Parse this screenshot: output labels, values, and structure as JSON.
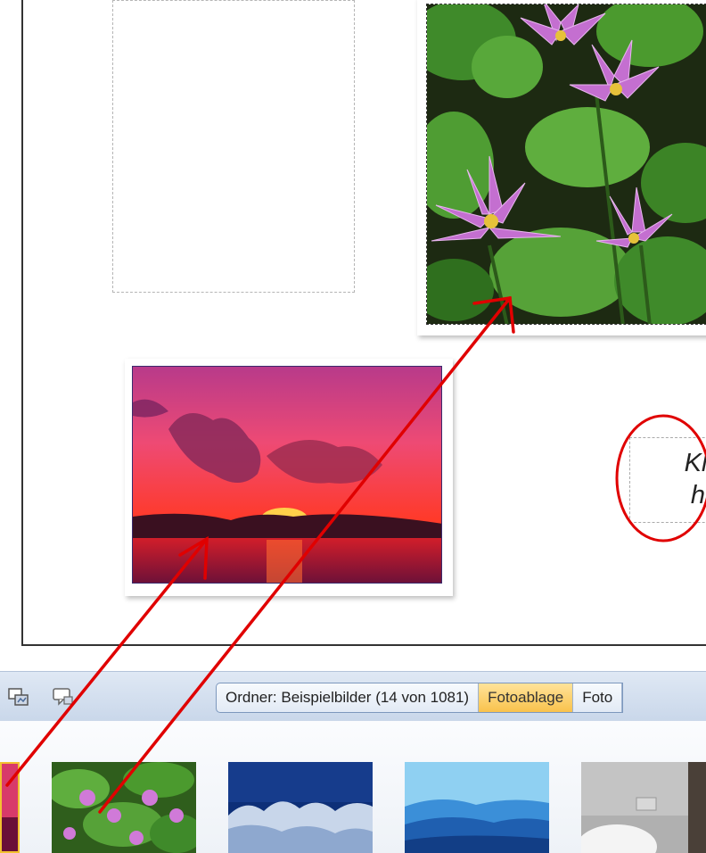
{
  "canvas": {
    "photos": [
      {
        "name": "water-lilies",
        "icon": "water-lily-photo"
      },
      {
        "name": "sunset",
        "icon": "sunset-photo"
      }
    ],
    "textbox": {
      "line1": "Klic",
      "line2": "hir"
    }
  },
  "toolbar": {
    "icons": [
      "image-settings-icon",
      "comment-icon"
    ],
    "folder_tab": "Ordner: Beispielbilder (14 von 1081)",
    "fotoablage_tab": "Fotoablage",
    "third_tab": "Foto"
  },
  "thumbnails": [
    {
      "name": "sunset",
      "selected": true
    },
    {
      "name": "water-lilies",
      "selected": false
    },
    {
      "name": "blue-forest",
      "selected": false
    },
    {
      "name": "blue-hills",
      "selected": false
    },
    {
      "name": "grey-photo",
      "selected": false
    }
  ],
  "colors": {
    "annotation": "#e00000",
    "active_tab": "#f9c24c",
    "toolbar": "#c9d7ea"
  }
}
